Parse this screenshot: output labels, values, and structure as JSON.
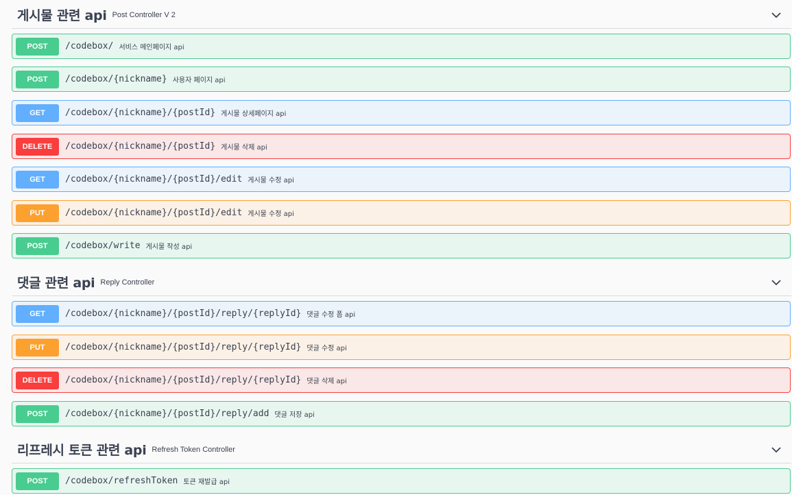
{
  "sections": [
    {
      "title": "게시물 관련 api",
      "description": "Post Controller V 2",
      "operations": [
        {
          "method": "POST",
          "path": "/codebox/",
          "summary": "서비스 메인페이지 api"
        },
        {
          "method": "POST",
          "path": "/codebox/{nickname}",
          "summary": "사용자 페이지 api"
        },
        {
          "method": "GET",
          "path": "/codebox/{nickname}/{postId}",
          "summary": "게시물 상세페이지 api"
        },
        {
          "method": "DELETE",
          "path": "/codebox/{nickname}/{postId}",
          "summary": "게시물 삭제 api"
        },
        {
          "method": "GET",
          "path": "/codebox/{nickname}/{postId}/edit",
          "summary": "게시물 수정 api"
        },
        {
          "method": "PUT",
          "path": "/codebox/{nickname}/{postId}/edit",
          "summary": "게시물 수정 api"
        },
        {
          "method": "POST",
          "path": "/codebox/write",
          "summary": "게시물 작성 api"
        }
      ]
    },
    {
      "title": "댓글 관련 api",
      "description": "Reply Controller",
      "operations": [
        {
          "method": "GET",
          "path": "/codebox/{nickname}/{postId}/reply/{replyId}",
          "summary": "댓글 수정 폼 api"
        },
        {
          "method": "PUT",
          "path": "/codebox/{nickname}/{postId}/reply/{replyId}",
          "summary": "댓글 수정 api"
        },
        {
          "method": "DELETE",
          "path": "/codebox/{nickname}/{postId}/reply/{replyId}",
          "summary": "댓글 삭제 api"
        },
        {
          "method": "POST",
          "path": "/codebox/{nickname}/{postId}/reply/add",
          "summary": "댓글 저장 api"
        }
      ]
    },
    {
      "title": "리프레시 토큰 관련 api",
      "description": "Refresh Token Controller",
      "operations": [
        {
          "method": "POST",
          "path": "/codebox/refreshToken",
          "summary": "토큰 재발급 api"
        }
      ]
    }
  ],
  "colors": {
    "post": "#49cc90",
    "get": "#61affe",
    "delete": "#f93e3e",
    "put": "#fca130"
  },
  "icons": {
    "collapse": "chevron-down-icon"
  }
}
